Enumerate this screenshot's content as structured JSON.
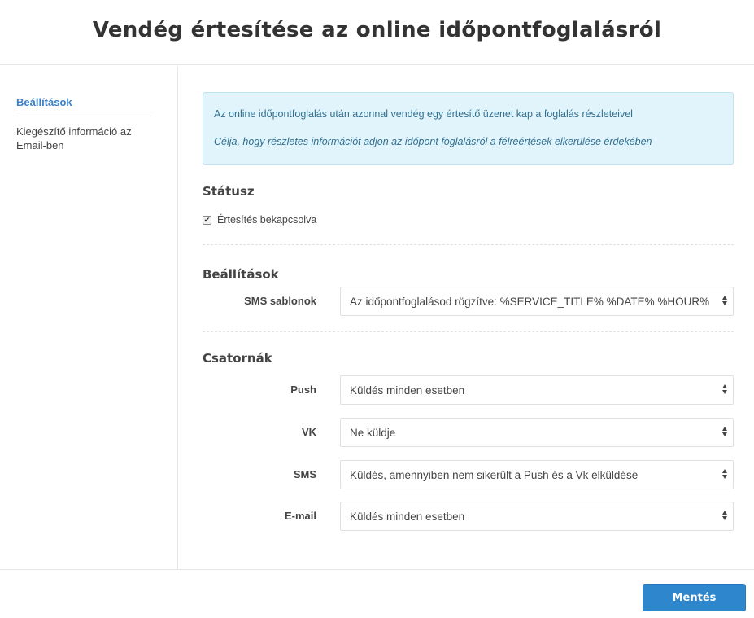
{
  "header": {
    "title": "Vendég értesítése az online időpontfoglalásról"
  },
  "sidebar": {
    "items": [
      {
        "label": "Beállítások",
        "active": true
      },
      {
        "label": "Kiegészítő információ az Email-ben",
        "active": false
      }
    ]
  },
  "info": {
    "line1": "Az online időpontfoglalás után azonnal vendég egy értesítő üzenet kap a foglalás részleteivel",
    "line2": "Célja, hogy részletes információt adjon az időpont foglalásról a félreértések elkerülése érdekében"
  },
  "status": {
    "title": "Státusz",
    "checkbox_label": "Értesítés bekapcsolva",
    "checked": true
  },
  "settings": {
    "title": "Beállítások",
    "sms_template_label": "SMS sablonok",
    "sms_template_value": "Az időpontfoglalásod rögzítve: %SERVICE_TITLE% %DATE% %HOUR%"
  },
  "channels": {
    "title": "Csatornák",
    "rows": [
      {
        "label": "Push",
        "value": "Küldés minden esetben"
      },
      {
        "label": "VK",
        "value": "Ne küldje"
      },
      {
        "label": "SMS",
        "value": "Küldés, amennyiben nem sikerült a Push és a Vk elküldése"
      },
      {
        "label": "E-mail",
        "value": "Küldés minden esetben"
      }
    ]
  },
  "footer": {
    "save_label": "Mentés"
  },
  "colors": {
    "accent": "#2e86cc",
    "link": "#3a7fc8",
    "info_bg": "#e1f3fb",
    "info_text": "#31708f"
  }
}
